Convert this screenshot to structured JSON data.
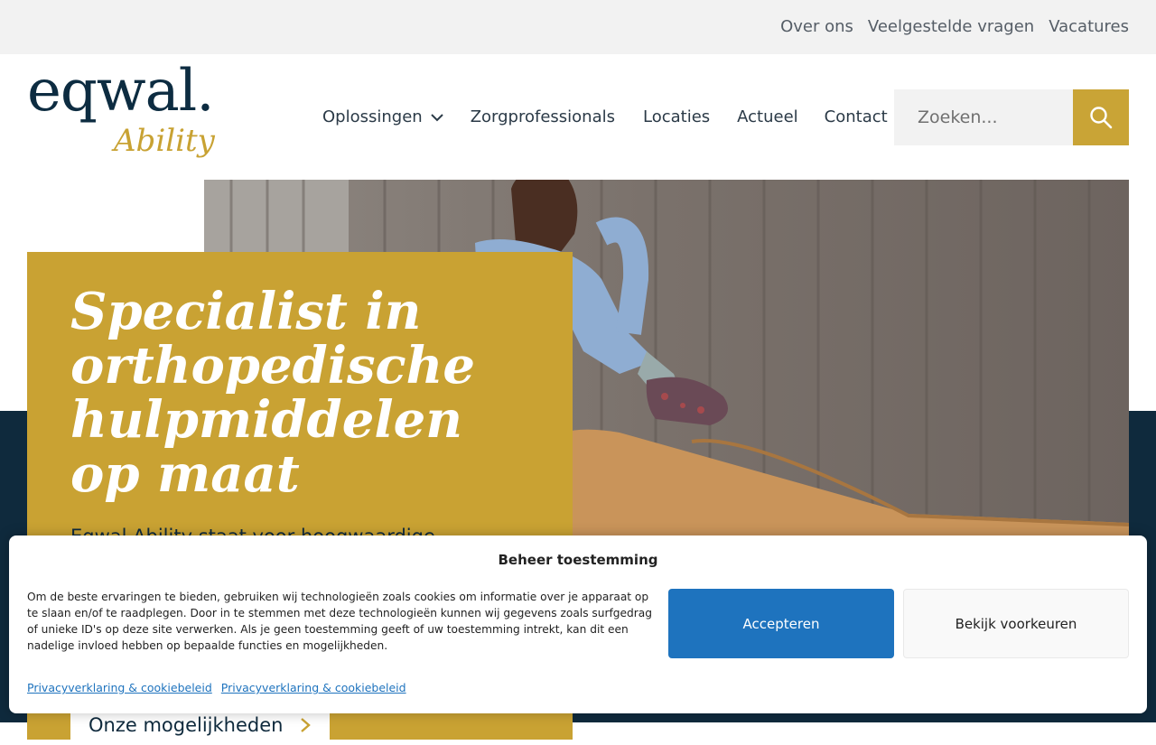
{
  "topbar": {
    "links": [
      "Over ons",
      "Veelgestelde vragen",
      "Vacatures"
    ]
  },
  "logo": {
    "wordmark": "eqwal.",
    "subtitle": "Ability"
  },
  "nav": {
    "items": [
      "Oplossingen",
      "Zorgprofessionals",
      "Locaties",
      "Actueel",
      "Contact"
    ],
    "dropdown_icon": "chevron-down-icon"
  },
  "search": {
    "placeholder": "Zoeken...",
    "icon": "search-icon"
  },
  "hero": {
    "title": "Specialist in orthopedische hulpmiddelen op maat",
    "description": "Eqwal Ability staat voor hoogwaardige",
    "cta_label": "Onze mogelijkheden",
    "cta_icon": "chevron-right-icon"
  },
  "cookie": {
    "title": "Beheer toestemming",
    "text": "Om de beste ervaringen te bieden, gebruiken wij technologieën zoals cookies om informatie over je apparaat op te slaan en/of te raadplegen. Door in te stemmen met deze technologieën kunnen wij gegevens zoals surfgedrag of unieke ID's op deze site verwerken. Als je geen toestemming geeft of uw toestemming intrekt, kan dit een nadelige invloed hebben op bepaalde functies en mogelijkheden.",
    "accept_label": "Accepteren",
    "prefs_label": "Bekijk voorkeuren",
    "links": [
      "Privacyverklaring & cookiebeleid",
      "Privacyverklaring & cookiebeleid"
    ]
  },
  "colors": {
    "navy": "#0f2a3d",
    "gold": "#c9a233",
    "accept_blue": "#1e73be",
    "topbar_bg": "#f2f2f2"
  }
}
